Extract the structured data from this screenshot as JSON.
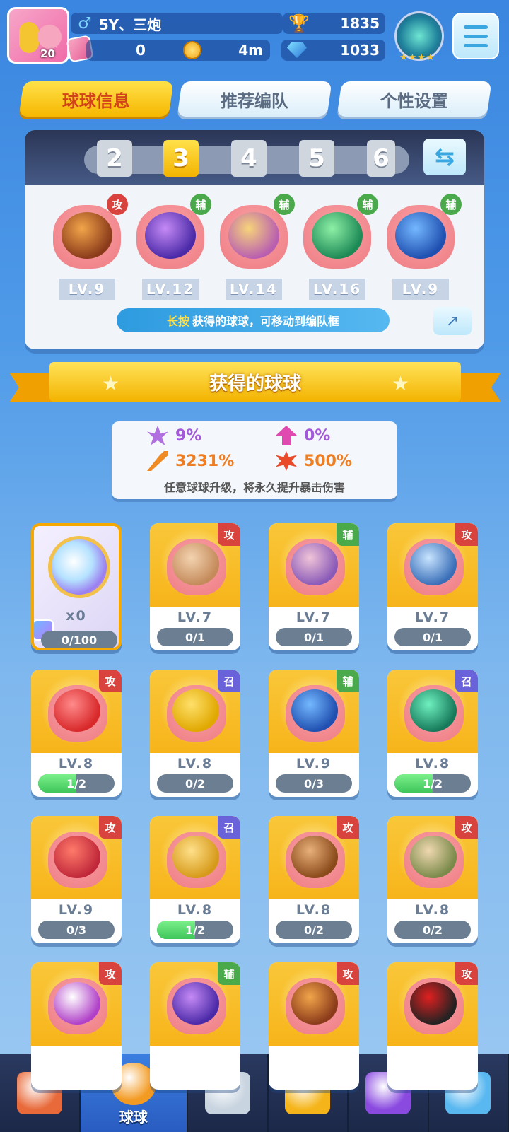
{
  "header": {
    "player_name": "5Y、三炮",
    "gender_symbol": "♂",
    "level": "20",
    "trophies": "1835",
    "coins": "0",
    "energy": "4m",
    "gems": "1033",
    "rank_stars": "★★★★"
  },
  "tabs": [
    {
      "label": "球球信息",
      "active": true
    },
    {
      "label": "推荐编队",
      "active": false
    },
    {
      "label": "个性设置",
      "active": false
    }
  ],
  "team": {
    "slots": [
      "2",
      "3",
      "4",
      "5",
      "6"
    ],
    "active_slot": "3",
    "swap_icon": "⇆",
    "share_icon": "↗",
    "hint_highlight": "长按",
    "hint_text": "获得的球球，可移动到编队框",
    "balls": [
      {
        "tag": "攻",
        "type": "atk",
        "level": "LV.9",
        "color": "#8b3b1a",
        "accent": "#f2a54a"
      },
      {
        "tag": "辅",
        "type": "sup",
        "level": "LV.12",
        "color": "#4b2aa8",
        "accent": "#c58af5"
      },
      {
        "tag": "辅",
        "type": "sup",
        "level": "LV.14",
        "color": "#b95fb0",
        "accent": "#f7d47a"
      },
      {
        "tag": "辅",
        "type": "sup",
        "level": "LV.16",
        "color": "#1d8a56",
        "accent": "#8ef0a6"
      },
      {
        "tag": "辅",
        "type": "sup",
        "level": "LV.9",
        "color": "#1f4fb0",
        "accent": "#74b8ff"
      }
    ]
  },
  "section_title": "获得的球球",
  "stats": {
    "crit_rate": "9%",
    "crit_up": "0%",
    "attack": "3231%",
    "crit_damage": "500%",
    "note": "任意球球升级，将永久提升暴击伤害"
  },
  "cards": [
    {
      "special": true,
      "count": "x0",
      "progress": "0/100",
      "fill": 0
    },
    {
      "tag": "攻",
      "type": "atk",
      "level": "LV.7",
      "progress": "0/1",
      "fill": 0,
      "color": "#c48a5a",
      "accent": "#f3d3b0"
    },
    {
      "tag": "辅",
      "type": "sup",
      "level": "LV.7",
      "progress": "0/1",
      "fill": 0,
      "color": "#8a5ab8",
      "accent": "#f0c4d8"
    },
    {
      "tag": "攻",
      "type": "atk",
      "level": "LV.7",
      "progress": "0/1",
      "fill": 0,
      "color": "#3a6fb8",
      "accent": "#c8e4ff"
    },
    {
      "tag": "攻",
      "type": "atk",
      "level": "LV.8",
      "progress": "1/2",
      "fill": 0.5,
      "color": "#d8282a",
      "accent": "#ff8a8a"
    },
    {
      "tag": "召",
      "type": "sum",
      "level": "LV.8",
      "progress": "0/2",
      "fill": 0,
      "color": "#e0a800",
      "accent": "#ffe06a"
    },
    {
      "tag": "辅",
      "type": "sup",
      "level": "LV.9",
      "progress": "0/3",
      "fill": 0,
      "color": "#1f4fb0",
      "accent": "#74b8ff"
    },
    {
      "tag": "召",
      "type": "sum",
      "level": "LV.8",
      "progress": "1/2",
      "fill": 0.5,
      "color": "#167a5a",
      "accent": "#6ff0c0"
    },
    {
      "tag": "攻",
      "type": "atk",
      "level": "LV.9",
      "progress": "0/3",
      "fill": 0,
      "color": "#c0283a",
      "accent": "#ff7a6a"
    },
    {
      "tag": "召",
      "type": "sum",
      "level": "LV.8",
      "progress": "1/2",
      "fill": 0.5,
      "color": "#d69a1a",
      "accent": "#ffe08a"
    },
    {
      "tag": "攻",
      "type": "atk",
      "level": "LV.8",
      "progress": "0/2",
      "fill": 0,
      "color": "#8a4a1a",
      "accent": "#e8b07a"
    },
    {
      "tag": "攻",
      "type": "atk",
      "level": "LV.8",
      "progress": "0/2",
      "fill": 0,
      "color": "#7a8a4a",
      "accent": "#f0d8b0"
    },
    {
      "tag": "攻",
      "type": "atk",
      "level": "",
      "progress": "",
      "fill": 0,
      "color": "#b040c8",
      "accent": "#ffffff"
    },
    {
      "tag": "辅",
      "type": "sup",
      "level": "",
      "progress": "",
      "fill": 0,
      "color": "#4b2aa8",
      "accent": "#c58af5"
    },
    {
      "tag": "攻",
      "type": "atk",
      "level": "",
      "progress": "",
      "fill": 0,
      "color": "#8b3b1a",
      "accent": "#f2a54a"
    },
    {
      "tag": "攻",
      "type": "atk",
      "level": "",
      "progress": "",
      "fill": 0,
      "color": "#222",
      "accent": "#e02020"
    }
  ],
  "nav": [
    {
      "name": "shop-icon",
      "label": "",
      "color": "#e86a3a"
    },
    {
      "name": "balls-icon",
      "label": "球球",
      "color": "#f39a22",
      "active": true
    },
    {
      "name": "battle-swords-icon",
      "label": "",
      "color": "#c8d4e0"
    },
    {
      "name": "whistle-icon",
      "label": "",
      "color": "#f5b51a"
    },
    {
      "name": "planet-icon",
      "label": "",
      "color": "#8a4ae0"
    },
    {
      "name": "chat-heart-icon",
      "label": "",
      "color": "#5ab8f0"
    }
  ]
}
